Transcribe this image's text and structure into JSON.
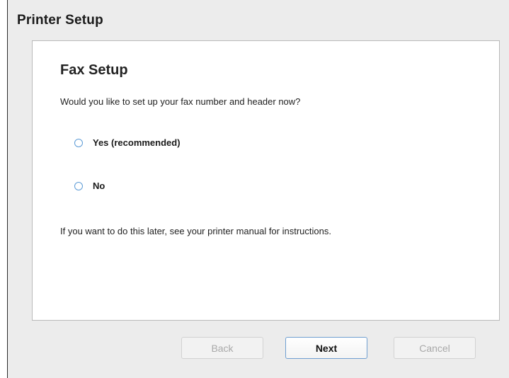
{
  "window": {
    "title": "Printer Setup"
  },
  "panel": {
    "heading": "Fax Setup",
    "question": "Would you like to set up your fax number and header now?",
    "options": [
      {
        "label": "Yes (recommended)",
        "selected": false
      },
      {
        "label": "No",
        "selected": false
      }
    ],
    "note": "If you want to do this later, see your printer manual for instructions."
  },
  "buttons": {
    "back": {
      "label": "Back",
      "enabled": false
    },
    "next": {
      "label": "Next",
      "enabled": true
    },
    "cancel": {
      "label": "Cancel",
      "enabled": false
    }
  },
  "colors": {
    "radio_accent": "#5d9bd6",
    "default_button_border": "#6f9fd1"
  }
}
